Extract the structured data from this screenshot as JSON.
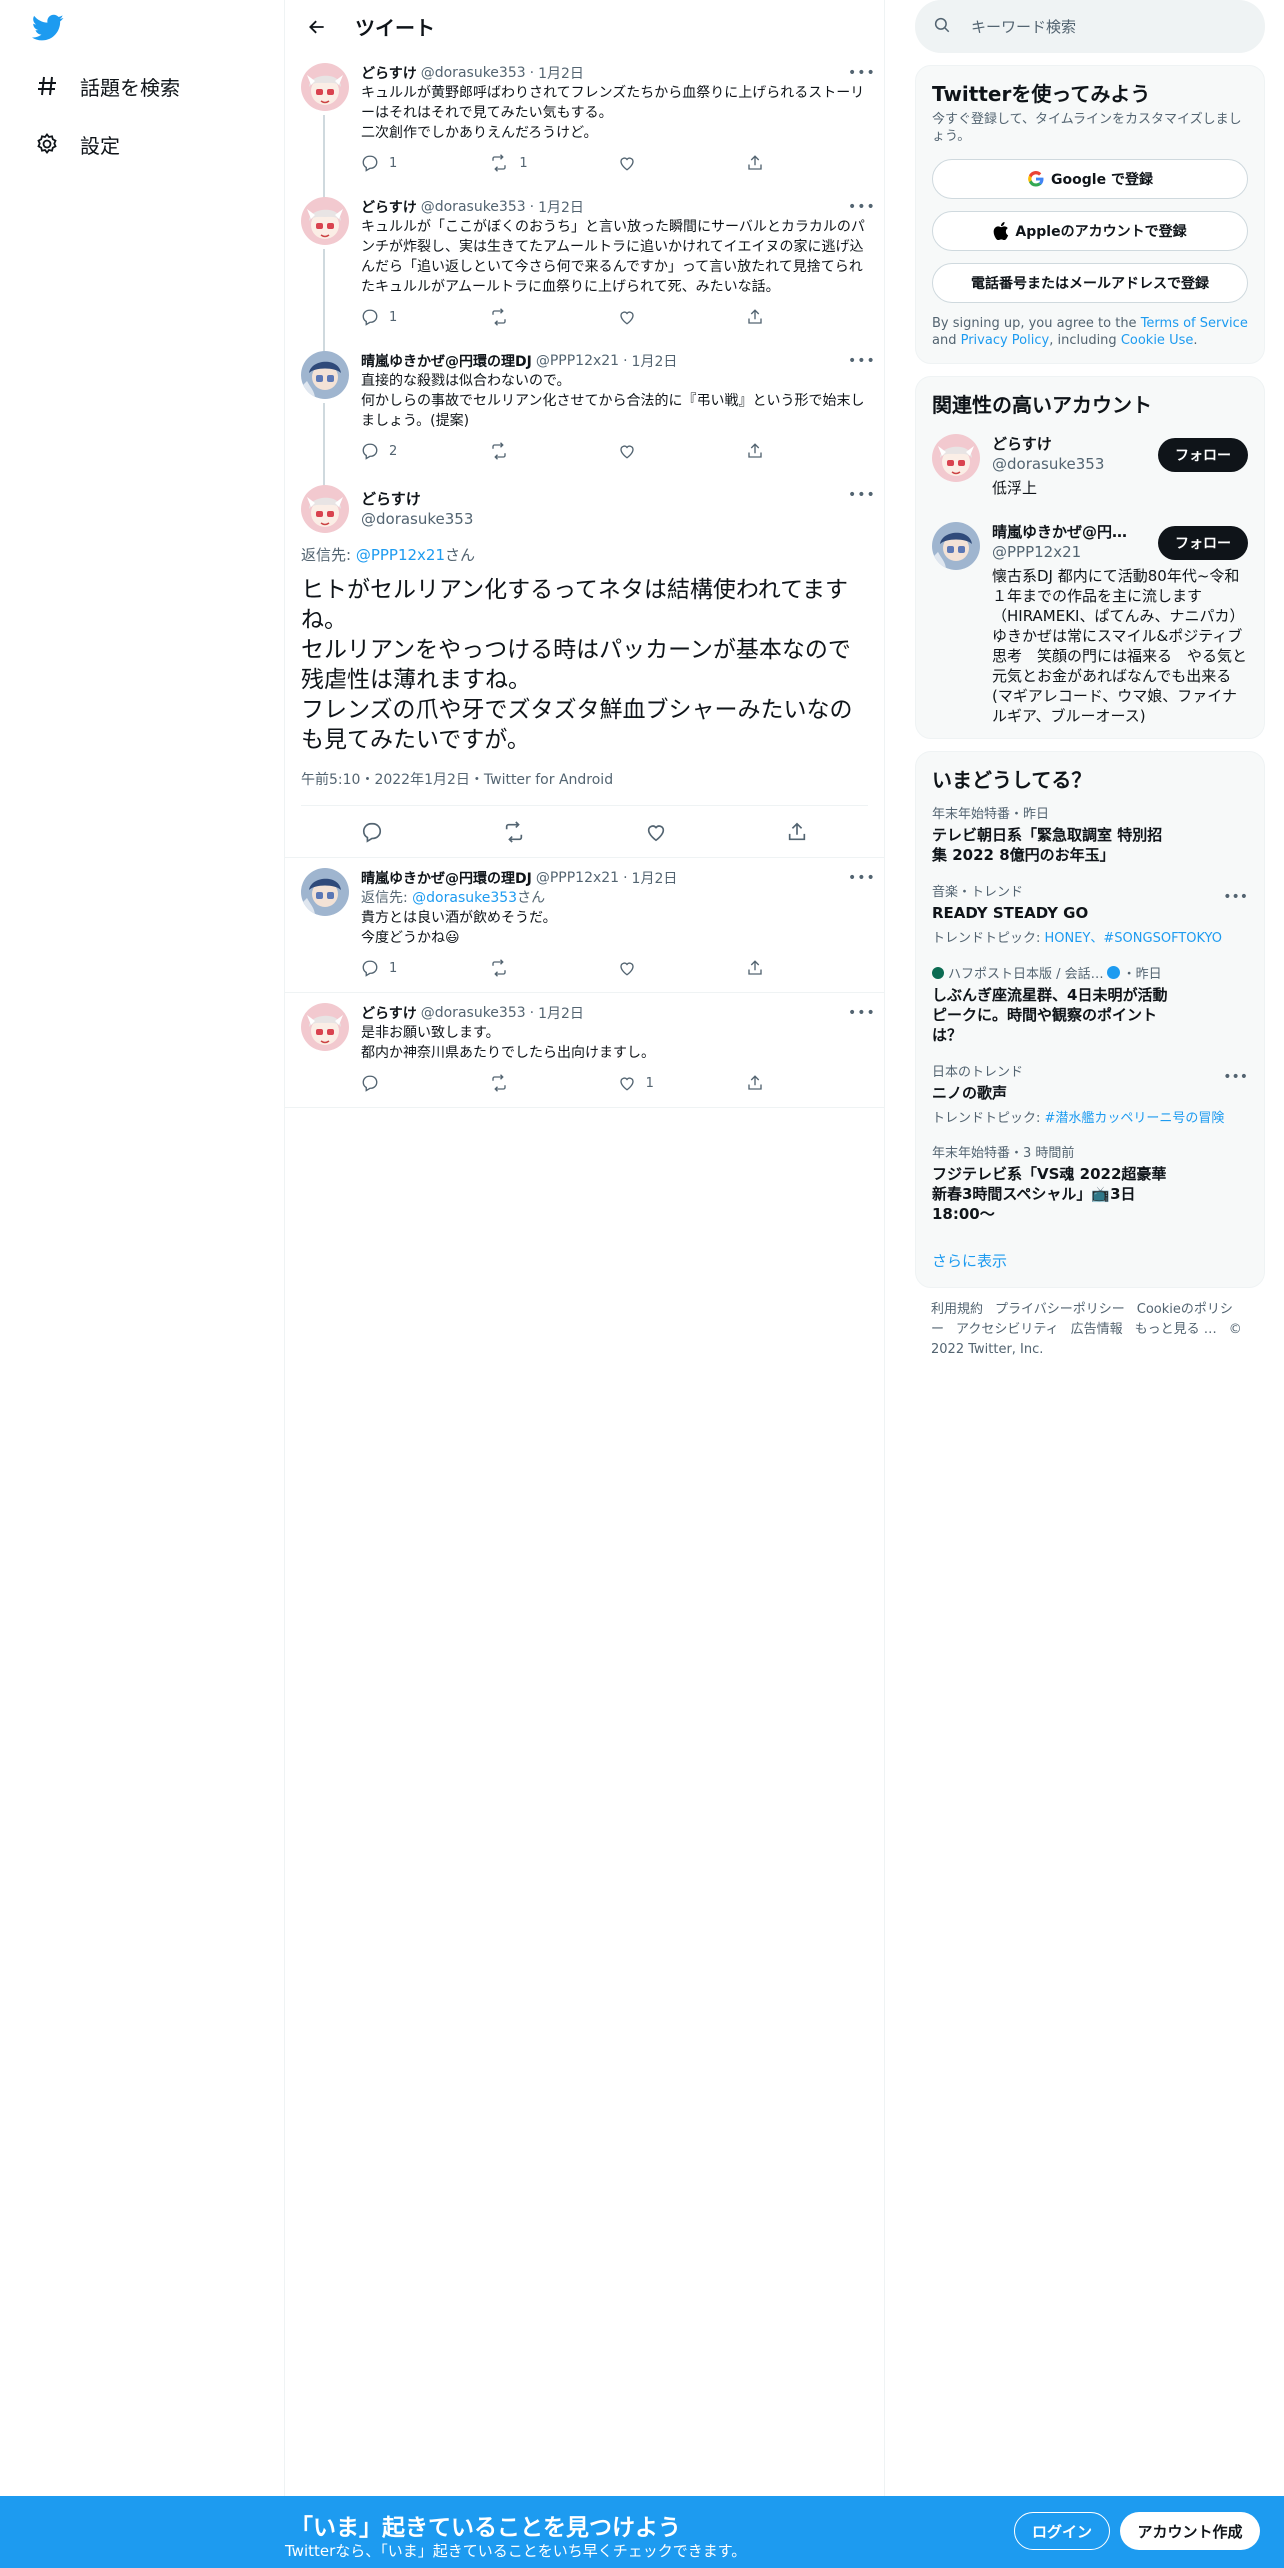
{
  "nav": {
    "explore_label": "話題を検索",
    "settings_label": "設定"
  },
  "header": {
    "title": "ツイート"
  },
  "thread": [
    {
      "name": "どらすけ",
      "handle": "@dorasuke353",
      "date": "1月2日",
      "text": "キュルルが黄野郎呼ばわりされてフレンズたちから血祭りに上げられるストーリーはそれはそれで見てみたい気もする。\n二次創作でしかありえんだろうけど。",
      "replies": "1",
      "retweets": "1",
      "likes": ""
    },
    {
      "name": "どらすけ",
      "handle": "@dorasuke353",
      "date": "1月2日",
      "text": "キュルルが「ここがぼくのおうち」と言い放った瞬間にサーバルとカラカルのパンチが炸裂し、実は生きてたアムールトラに追いかけれてイエイヌの家に逃げ込んだら「追い返しといて今さら何で来るんですか」って言い放たれて見捨てられたキュルルがアムールトラに血祭りに上げられて死、みたいな話。",
      "replies": "1",
      "retweets": "",
      "likes": ""
    },
    {
      "name": "晴嵐ゆきかぜ@円環の理DJ",
      "handle": "@PPP12x21",
      "date": "1月2日",
      "text": "直接的な殺戮は似合わないので。\n何かしらの事故でセルリアン化させてから合法的に『弔い戦』という形で始末しましょう。(提案)",
      "replies": "2",
      "retweets": "",
      "likes": ""
    }
  ],
  "focus": {
    "name": "どらすけ",
    "handle": "@dorasuke353",
    "reply_prefix": "返信先: ",
    "reply_to": "@PPP12x21",
    "reply_suffix": "さん",
    "text": "ヒトがセルリアン化するってネタは結構使われてますね。\nセルリアンをやっつける時はパッカーンが基本なので残虐性は薄れますね。\nフレンズの爪や牙でズタズタ鮮血ブシャーみたいなのも見てみたいですが。",
    "meta": "午前5:10・2022年1月2日・Twitter for Android"
  },
  "replies": [
    {
      "name": "晴嵐ゆきかぜ@円環の理DJ",
      "handle": "@PPP12x21",
      "date": "1月2日",
      "reply_prefix": "返信先: ",
      "reply_to": "@dorasuke353",
      "reply_suffix": "さん",
      "text": "貴方とは良い酒が飲めそうだ。\n今度どうかね😃",
      "replies": "1",
      "retweets": "",
      "likes": ""
    },
    {
      "name": "どらすけ",
      "handle": "@dorasuke353",
      "date": "1月2日",
      "text": "是非お願い致します。\n都内か神奈川県あたりでしたら出向けますし。",
      "replies": "",
      "retweets": "",
      "likes": "1"
    }
  ],
  "right": {
    "search_placeholder": "キーワード検索",
    "signup": {
      "title": "Twitterを使ってみよう",
      "subtitle": "今すぐ登録して、タイムラインをカスタマイズしましょう。",
      "google": "Google で登録",
      "apple": "Appleのアカウントで登録",
      "phone": "電話番号またはメールアドレスで登録",
      "legal_1": "By signing up, you agree to the ",
      "tos": "Terms of Service",
      "legal_2": " and ",
      "privacy": "Privacy Policy",
      "legal_3": ", including ",
      "cookie": "Cookie Use",
      "legal_4": "."
    },
    "related": {
      "title": "関連性の高いアカウント",
      "follow_label": "フォロー",
      "accounts": [
        {
          "name": "どらすけ",
          "handle": "@dorasuke353",
          "bio": "低浮上"
        },
        {
          "name": "晴嵐ゆきかぜ@円環の理DJ",
          "handle": "@PPP12x21",
          "bio": "懐古系DJ 都内にて活動80年代~令和１年までの作品を主に流します（HIRAMEKI、ぱてんみ、ナニパカ）ゆきかぜは常にスマイル&ポジティブ思考　笑顔の門には福来る　やる気と元気とお金があればなんでも出来る(マギアレコード、ウマ娘、ファイナルギア、ブルーオース)"
        }
      ]
    },
    "trends": {
      "title": "いまどうしてる？",
      "items": [
        {
          "context": "年末年始特番・昨日",
          "name": "テレビ朝日系「緊急取調室 特別招集 2022 8億円のお年玉」",
          "sub_prefix": "",
          "sub_links": ""
        },
        {
          "context": "音楽・トレンド",
          "name": "READY STEADY GO",
          "sub_prefix": "トレンドトピック: ",
          "sub_links": "HONEY、#SONGSOFTOKYO"
        },
        {
          "context": "ハフポスト日本版 / 会話…",
          "context_suffix": "・昨日",
          "name": "しぶんぎ座流星群、4日未明が活動ピークに。時間や観察のポイントは？",
          "sub_prefix": "",
          "sub_links": ""
        },
        {
          "context": "日本のトレンド",
          "name": "ニノの歌声",
          "sub_prefix": "トレンドトピック: ",
          "sub_links": "#潜水艦カッペリーニ号の冒険"
        },
        {
          "context": "年末年始特番・3 時間前",
          "name": "フジテレビ系「VS魂 2022超豪華新春3時間スペシャル」📺3日18:00〜",
          "sub_prefix": "",
          "sub_links": ""
        }
      ],
      "show_more": "さらに表示"
    },
    "footer": {
      "links": [
        "利用規約",
        "プライバシーポリシー",
        "Cookieのポリシー",
        "アクセシビリティ",
        "広告情報",
        "もっと見る …",
        "© 2022 Twitter, Inc."
      ]
    }
  },
  "bottom": {
    "title": "「いま」起きていることを見つけよう",
    "subtitle": "Twitterなら、「いま」起きていることをいち早くチェックできます。",
    "login": "ログイン",
    "signup": "アカウント作成"
  },
  "colors": {
    "accent": "#1d9bf0",
    "text": "#0f1419",
    "muted": "#536471"
  }
}
